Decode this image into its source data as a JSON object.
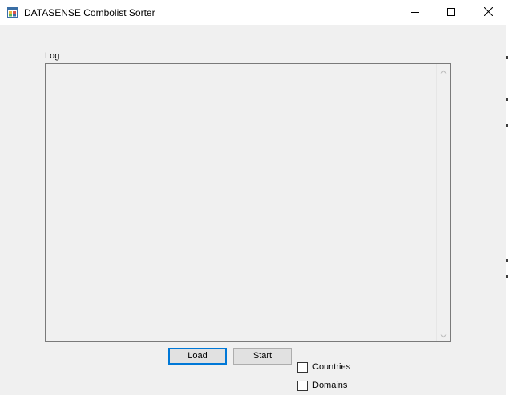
{
  "window": {
    "title": "DATASENSE Combolist Sorter",
    "app_icon": "windows-form-icon",
    "minimize_icon": "minimize-icon",
    "maximize_icon": "maximize-icon",
    "close_icon": "close-icon"
  },
  "log": {
    "label": "Log",
    "content": ""
  },
  "buttons": {
    "load_label": "Load",
    "start_label": "Start"
  },
  "options": {
    "countries_label": "Countries",
    "countries_checked": false,
    "domains_label": "Domains",
    "domains_checked": false
  },
  "colors": {
    "focus_accent": "#0078d7",
    "window_background": "#f0f0f0",
    "titlebar_background": "#ffffff"
  }
}
